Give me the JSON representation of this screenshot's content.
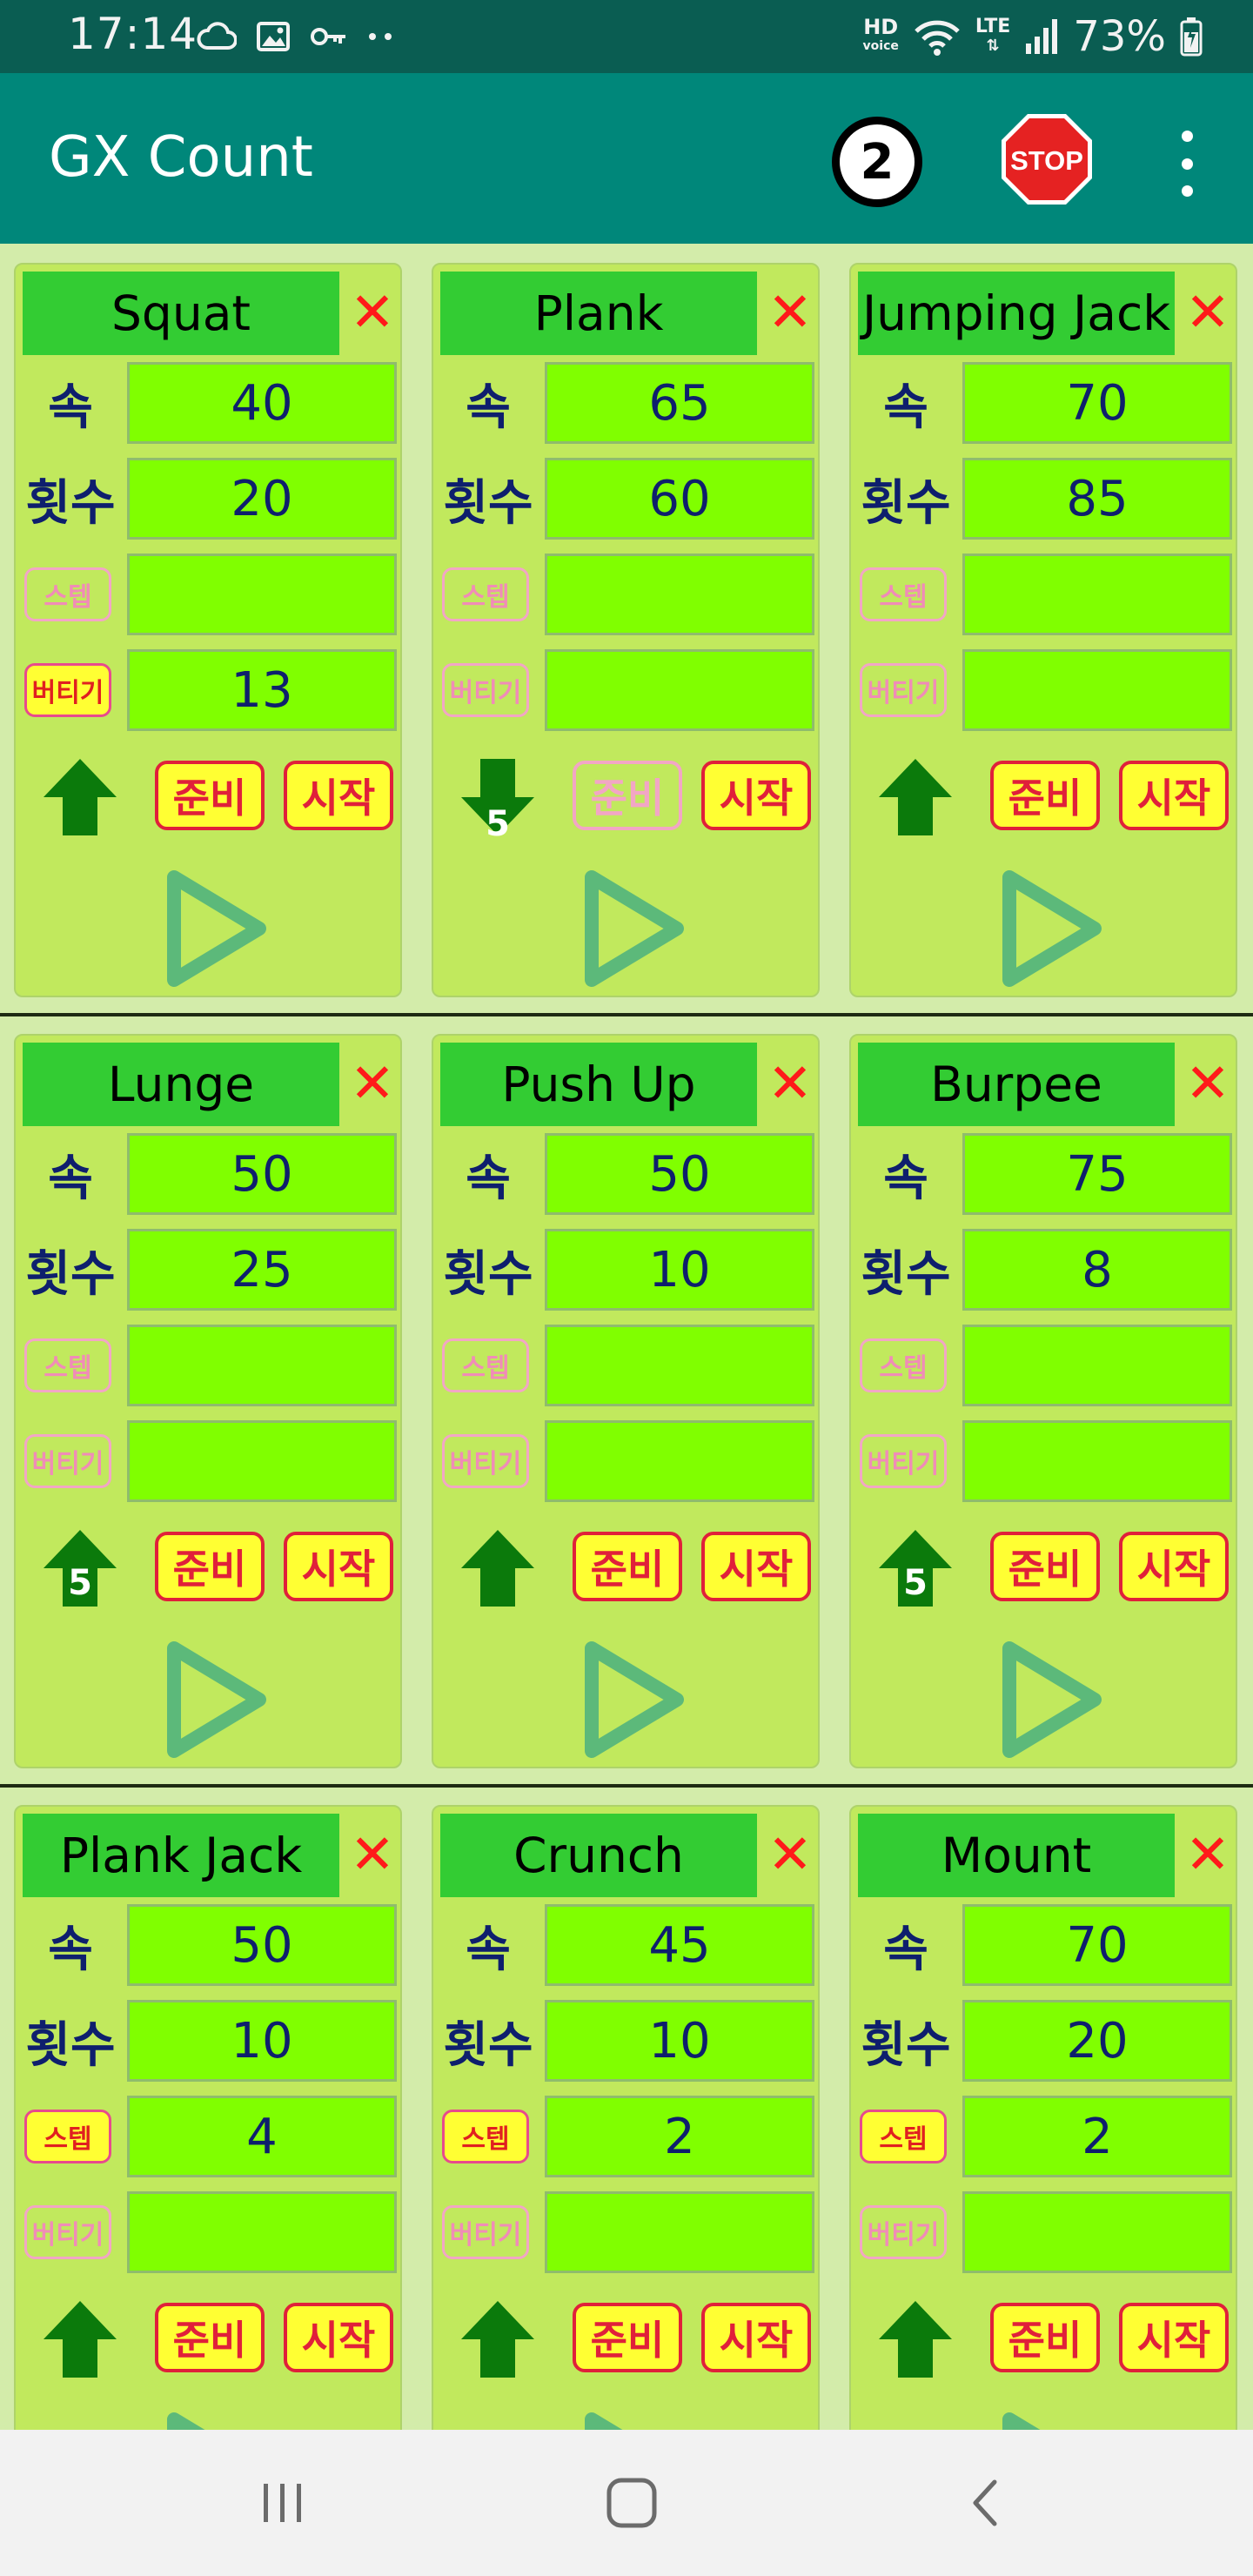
{
  "status_bar": {
    "time": "17:14",
    "battery": "73%",
    "hd_top": "HD",
    "hd_bottom": "voice",
    "lte": "LTE",
    "left_icons": [
      "cloud-icon",
      "image-icon",
      "key-icon",
      "more-dots-icon"
    ],
    "right_icons": [
      "hd-voice-icon",
      "wifi-icon",
      "lte-icon",
      "signal-icon",
      "battery-icon"
    ]
  },
  "app_bar": {
    "title": "GX Count",
    "counter": "2",
    "stop_label": "STOP",
    "stop_color": "#e52222",
    "menu_icon": "more-vert-icon"
  },
  "colors": {
    "app_bar": "#00877a",
    "status_bar": "#0a5d52",
    "card_bg": "#c1e95d",
    "title_bg": "#33cc33",
    "field_bg": "#80ff00",
    "accent_red": "#e0203a",
    "button_yellow": "#ffff33",
    "arrow_green": "#0b7a0b",
    "play_green": "#5cb97a"
  },
  "labels": {
    "speed": "속",
    "reps": "횟수",
    "step": "스텝",
    "hold": "버티기",
    "ready": "준비",
    "start": "시작",
    "close": "✕"
  },
  "exercises": [
    {
      "name": "Squat",
      "speed": "40",
      "reps": "20",
      "step": "",
      "hold": "13",
      "step_active": false,
      "hold_active": true,
      "arrow": "up",
      "arrow_num": "",
      "ready_enabled": true
    },
    {
      "name": "Plank",
      "speed": "65",
      "reps": "60",
      "step": "",
      "hold": "",
      "step_active": false,
      "hold_active": false,
      "arrow": "down",
      "arrow_num": "5",
      "ready_enabled": false
    },
    {
      "name": "Jumping Jack",
      "speed": "70",
      "reps": "85",
      "step": "",
      "hold": "",
      "step_active": false,
      "hold_active": false,
      "arrow": "up",
      "arrow_num": "",
      "ready_enabled": true
    },
    {
      "name": "Lunge",
      "speed": "50",
      "reps": "25",
      "step": "",
      "hold": "",
      "step_active": false,
      "hold_active": false,
      "arrow": "up",
      "arrow_num": "5",
      "ready_enabled": true
    },
    {
      "name": "Push Up",
      "speed": "50",
      "reps": "10",
      "step": "",
      "hold": "",
      "step_active": false,
      "hold_active": false,
      "arrow": "up",
      "arrow_num": "",
      "ready_enabled": true
    },
    {
      "name": "Burpee",
      "speed": "75",
      "reps": "8",
      "step": "",
      "hold": "",
      "step_active": false,
      "hold_active": false,
      "arrow": "up",
      "arrow_num": "5",
      "ready_enabled": true
    },
    {
      "name": "Plank Jack",
      "speed": "50",
      "reps": "10",
      "step": "4",
      "hold": "",
      "step_active": true,
      "hold_active": false,
      "arrow": "up",
      "arrow_num": "",
      "ready_enabled": true
    },
    {
      "name": "Crunch",
      "speed": "45",
      "reps": "10",
      "step": "2",
      "hold": "",
      "step_active": true,
      "hold_active": false,
      "arrow": "up",
      "arrow_num": "",
      "ready_enabled": true
    },
    {
      "name": "Mount",
      "speed": "70",
      "reps": "20",
      "step": "2",
      "hold": "",
      "step_active": true,
      "hold_active": false,
      "arrow": "up",
      "arrow_num": "",
      "ready_enabled": true
    }
  ],
  "nav_bar": {
    "icons": [
      "recent-apps-icon",
      "home-icon",
      "back-icon"
    ]
  }
}
